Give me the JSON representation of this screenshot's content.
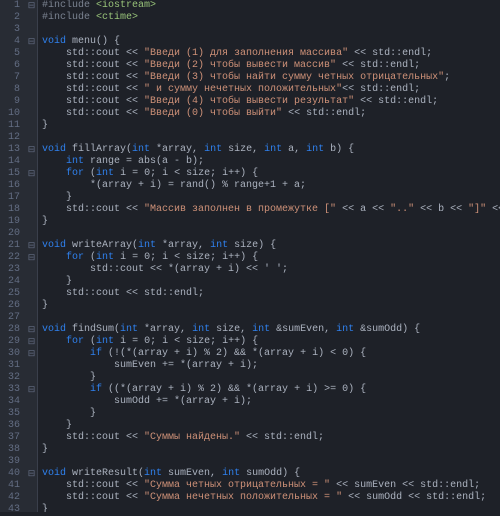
{
  "lineCount": 43,
  "fold": {
    "1": "⊟",
    "4": "⊟",
    "13": "⊟",
    "15": "⊟",
    "21": "⊟",
    "22": "⊟",
    "28": "⊟",
    "29": "⊟",
    "30": "⊟",
    "33": "⊟",
    "40": "⊟"
  },
  "code": {
    "l1": {
      "a": "#include ",
      "b": "<iostream>"
    },
    "l2": {
      "a": "#include ",
      "b": "<ctime>"
    },
    "l4": {
      "kw": "void",
      "fn": " menu() {"
    },
    "l5": {
      "pre": "    std::cout << ",
      "s": "\"Введи (1) для заполнения массива\"",
      "post": " << std::endl;"
    },
    "l6": {
      "pre": "    std::cout << ",
      "s": "\"Введи (2) чтобы вывести массив\"",
      "post": " << std::endl;"
    },
    "l7": {
      "pre": "    std::cout << ",
      "s": "\"Введи (3) чтобы найти сумму четных отрицательных\"",
      "post": ";"
    },
    "l8": {
      "pre": "    std::cout << ",
      "s": "\" и сумму нечетных положительных\"",
      "post": "<< std::endl;"
    },
    "l9": {
      "pre": "    std::cout << ",
      "s": "\"Введи (4) чтобы вывести результат\"",
      "post": " << std::endl;"
    },
    "l10": {
      "pre": "    std::cout << ",
      "s": "\"Введи (0) чтобы выйти\"",
      "post": " << std::endl;"
    },
    "l11": {
      "t": "}"
    },
    "l13": {
      "kw": "void",
      "fn": " fillArray(",
      "p": "int *array, int size, int a, int b",
      "e": ") {"
    },
    "l14": {
      "pre": "    ",
      "kw": "int",
      "rest": " range = abs(a - b);"
    },
    "l15": {
      "pre": "    ",
      "kw": "for",
      "rest": " (",
      "kw2": "int",
      "r2": " i = 0; i < size; i++) {"
    },
    "l16": {
      "t": "        *(array + i) = rand() % range+1 + a;"
    },
    "l17": {
      "t": "    }"
    },
    "l18": {
      "pre": "    std::cout << ",
      "s": "\"Массив заполнен в промежутке [\"",
      "m1": " << a << ",
      "s2": "\"..\"",
      "m2": " << b << ",
      "s3": "\"]\"",
      "post": " << std::endl;"
    },
    "l19": {
      "t": "}"
    },
    "l21": {
      "kw": "void",
      "fn": " writeArray(",
      "p": "int *array, int size",
      "e": ") {"
    },
    "l22": {
      "pre": "    ",
      "kw": "for",
      "rest": " (",
      "kw2": "int",
      "r2": " i = 0; i < size; i++) {"
    },
    "l23": {
      "t": "        std::cout << *(array + i) << ' ';"
    },
    "l24": {
      "t": "    }"
    },
    "l25": {
      "t": "    std::cout << std::endl;"
    },
    "l26": {
      "t": "}"
    },
    "l28": {
      "kw": "void",
      "fn": " findSum(",
      "p": "int *array, int size, int &sumEven, int &sumOdd",
      "e": ") {"
    },
    "l29": {
      "pre": "    ",
      "kw": "for",
      "rest": " (",
      "kw2": "int",
      "r2": " i = 0; i < size; i++) {"
    },
    "l30": {
      "pre": "        ",
      "kw": "if",
      "rest": " (!(*(array + i) % 2) && *(array + i) < 0) {"
    },
    "l31": {
      "t": "            sumEven += *(array + i);"
    },
    "l32": {
      "t": "        }"
    },
    "l33": {
      "pre": "        ",
      "kw": "if",
      "rest": " ((*(array + i) % 2) && *(array + i) >= 0) {"
    },
    "l34": {
      "t": "            sumOdd += *(array + i);"
    },
    "l35": {
      "t": "        }"
    },
    "l36": {
      "t": "    }"
    },
    "l37": {
      "pre": "    std::cout << ",
      "s": "\"Суммы найдены.\"",
      "post": " << std::endl;"
    },
    "l38": {
      "t": "}"
    },
    "l40": {
      "kw": "void",
      "fn": " writeResult(",
      "p": "int sumEven, int sumOdd",
      "e": ") {"
    },
    "l41": {
      "pre": "    std::cout << ",
      "s": "\"Сумма четных отрицательных = \"",
      "post": " << sumEven << std::endl;"
    },
    "l42": {
      "pre": "    std::cout << ",
      "s": "\"Сумма нечетных положительных = \"",
      "post": " << sumOdd << std::endl;"
    },
    "l43": {
      "t": "}"
    }
  }
}
